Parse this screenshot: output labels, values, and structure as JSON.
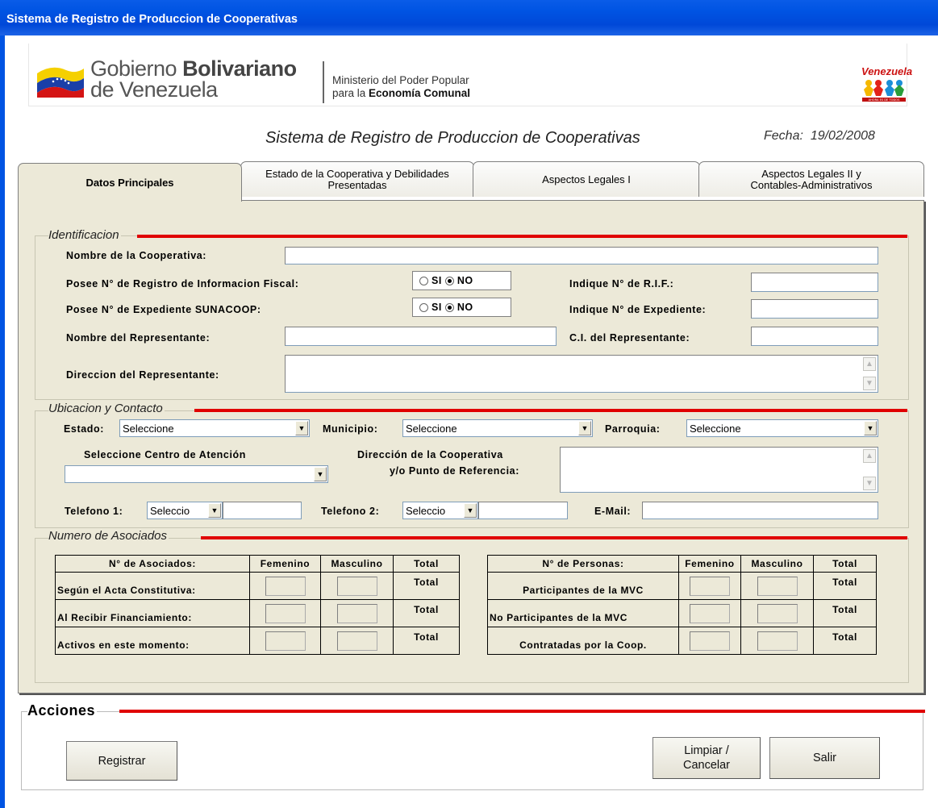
{
  "window": {
    "title": "Sistema de Registro de Produccion de Cooperativas"
  },
  "banner": {
    "gov_line1_a": "Gobierno ",
    "gov_line1_b": "Bolivariano",
    "gov_line2": "de Venezuela",
    "ministry_line1": "Ministerio del Poder Popular",
    "ministry_line2_a": "para la ",
    "ministry_line2_b": "Economía Comunal",
    "logo_text": "Venezuela",
    "logo_caption": "AHORA ES DE TODOS"
  },
  "header": {
    "title": "Sistema de Registro de Produccion de Cooperativas",
    "fecha_label": "Fecha:",
    "fecha_value": "19/02/2008"
  },
  "tabs": [
    {
      "label": "Datos Principales",
      "active": true
    },
    {
      "label": "Estado de la Cooperativa y Debilidades Presentadas"
    },
    {
      "label": "Aspectos Legales I"
    },
    {
      "label": "Aspectos Legales II y Contables-Administrativos"
    }
  ],
  "identificacion": {
    "title": "Identificacion",
    "nombre_coop": "Nombre de la Cooperativa:",
    "posee_rif": "Posee N° de Registro de Informacion Fiscal:",
    "posee_exp": "Posee N° de Expediente SUNACOOP:",
    "si": "SI",
    "no": "NO",
    "indique_rif": "Indique N° de R.I.F.:",
    "indique_exp": "Indique N° de Expediente:",
    "nombre_rep": "Nombre del Representante:",
    "ci_rep": "C.I. del Representante:",
    "dir_rep": "Direccion del Representante:"
  },
  "ubicacion": {
    "title": "Ubicacion y Contacto",
    "estado_label": "Estado:",
    "estado_value": "Seleccione",
    "municipio_label": "Municipio:",
    "municipio_value": "Seleccione",
    "parroquia_label": "Parroquia:",
    "parroquia_value": "Seleccione",
    "centro_label": "Seleccione Centro de Atención",
    "direccion_label1": "Dirección de la Cooperativa",
    "direccion_label2": "y/o Punto de Referencia:",
    "tel1_label": "Telefono 1:",
    "tel1_code": "Seleccio",
    "tel2_label": "Telefono 2:",
    "tel2_code": "Seleccio",
    "email_label": "E-Mail:"
  },
  "asociados": {
    "title": "Numero de Asociados",
    "left_headers": [
      "N° de Asociados:",
      "Femenino",
      "Masculino",
      "Total"
    ],
    "left_rows": [
      "Según el Acta Constitutiva:",
      "Al Recibir Financiamiento:",
      "Activos en este momento:"
    ],
    "right_headers": [
      "N° de Personas:",
      "Femenino",
      "Masculino",
      "Total"
    ],
    "right_rows": [
      "Participantes de la MVC",
      "No Participantes de la MVC",
      "Contratadas por la Coop."
    ],
    "total_word": "Total"
  },
  "acciones": {
    "title": "Acciones",
    "registrar": "Registrar",
    "limpiar_line1": "Limpiar /",
    "limpiar_line2": "Cancelar",
    "salir": "Salir"
  }
}
